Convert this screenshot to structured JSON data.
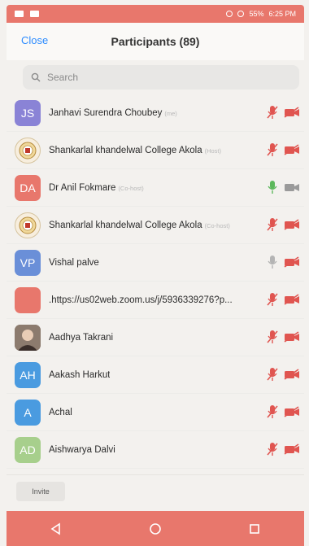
{
  "status_bar": {
    "time": "6:25 PM",
    "battery": "55%"
  },
  "header": {
    "close_label": "Close",
    "title": "Participants (89)"
  },
  "search": {
    "placeholder": "Search"
  },
  "participants": [
    {
      "initials": "JS",
      "name": "Janhavi Surendra Choubey",
      "role": "(me)",
      "avatar_color": "#8a83d6",
      "avatar_type": "initials",
      "mic": "muted",
      "video": "off"
    },
    {
      "initials": "",
      "name": "Shankarlal khandelwal College Akola",
      "role": "(Host)",
      "avatar_color": "",
      "avatar_type": "crest",
      "mic": "muted",
      "video": "off"
    },
    {
      "initials": "DA",
      "name": "Dr Anil Fokmare",
      "role": "(Co-host)",
      "avatar_color": "#e8776c",
      "avatar_type": "initials",
      "mic": "on",
      "video": "on"
    },
    {
      "initials": "",
      "name": "Shankarlal khandelwal College Akola",
      "role": "(Co-host)",
      "avatar_color": "",
      "avatar_type": "crest",
      "mic": "muted",
      "video": "off"
    },
    {
      "initials": "VP",
      "name": "Vishal palve",
      "role": "",
      "avatar_color": "#6a8fd8",
      "avatar_type": "initials",
      "mic": "idle",
      "video": "off"
    },
    {
      "initials": "",
      "name": ".https://us02web.zoom.us/j/5936339276?p...",
      "role": "",
      "avatar_color": "#e8776c",
      "avatar_type": "initials",
      "mic": "muted",
      "video": "off"
    },
    {
      "initials": "",
      "name": "Aadhya Takrani",
      "role": "",
      "avatar_color": "",
      "avatar_type": "photo",
      "mic": "muted",
      "video": "off"
    },
    {
      "initials": "AH",
      "name": "Aakash Harkut",
      "role": "",
      "avatar_color": "#4a9be0",
      "avatar_type": "initials",
      "mic": "muted",
      "video": "off"
    },
    {
      "initials": "A",
      "name": "Achal",
      "role": "",
      "avatar_color": "#4a9be0",
      "avatar_type": "initials",
      "mic": "muted",
      "video": "off"
    },
    {
      "initials": "AD",
      "name": "Aishwarya Dalvi",
      "role": "",
      "avatar_color": "#a7cf8c",
      "avatar_type": "initials",
      "mic": "muted",
      "video": "off"
    }
  ],
  "footer": {
    "invite_label": "Invite"
  },
  "colors": {
    "accent": "#2d8cff",
    "muted_red": "#e05550",
    "unmuted_green": "#5cb85c",
    "status_bar": "#e8776c"
  }
}
